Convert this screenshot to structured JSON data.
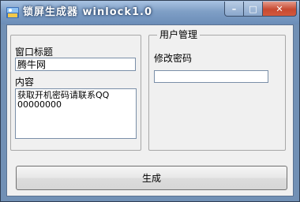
{
  "window": {
    "title": "锁屏生成器 winlock1.0",
    "icon": "app-icon",
    "controls": {
      "minimize": "–",
      "maximize": "□",
      "close": "✕"
    }
  },
  "left_group": {
    "title_label": "窗口标题",
    "title_value": "腾牛网",
    "content_label": "内容",
    "content_value": "获取开机密码请联系QQ\n00000000"
  },
  "right_group": {
    "legend": "用户管理",
    "password_label": "修改密码",
    "password_value": ""
  },
  "actions": {
    "generate_label": "生成"
  }
}
